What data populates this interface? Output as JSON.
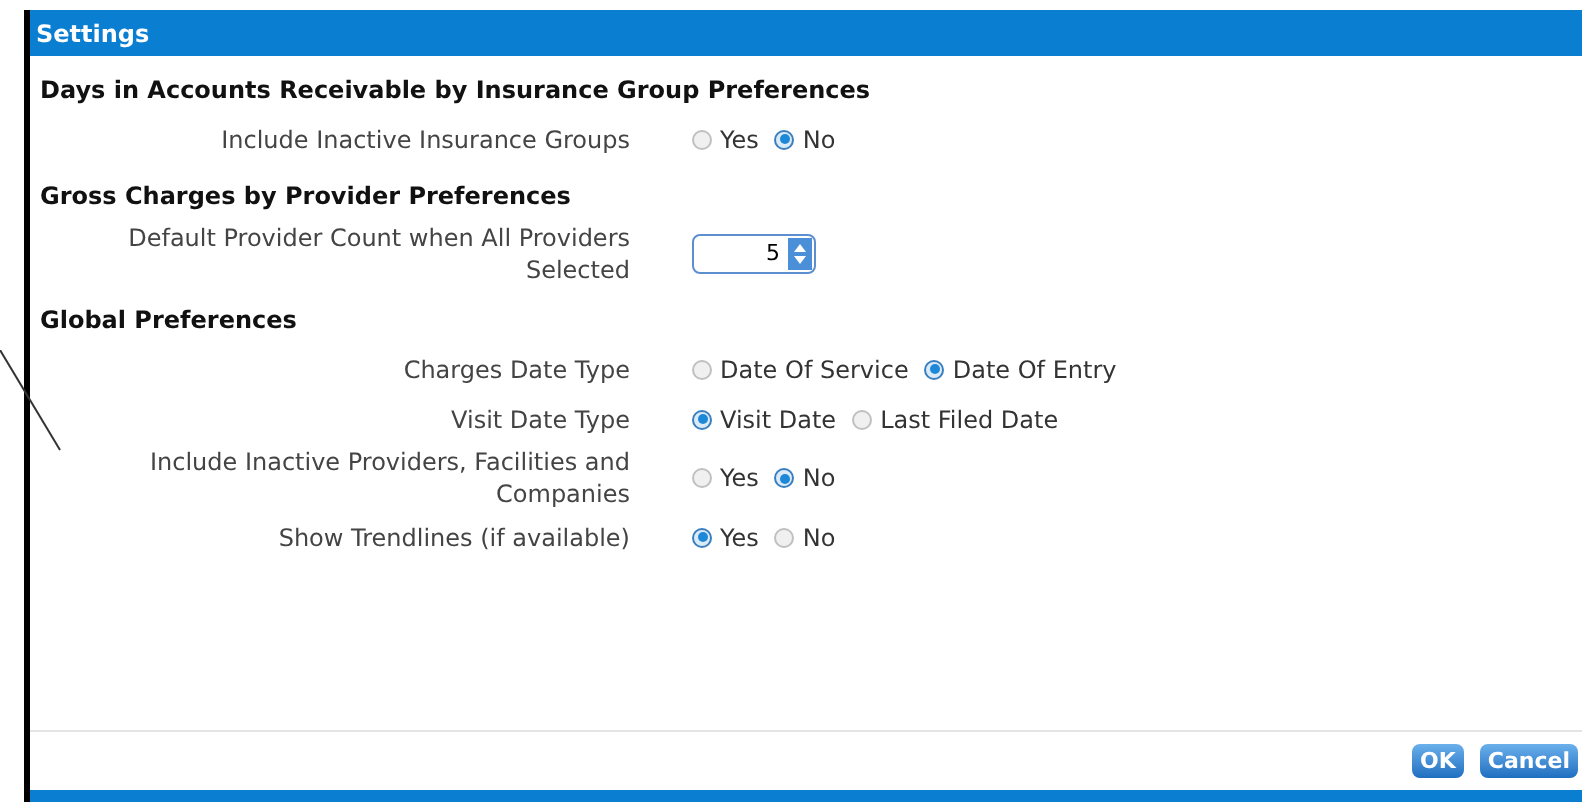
{
  "window": {
    "title": "Settings"
  },
  "sections": [
    {
      "heading": "Days in Accounts Receivable by Insurance Group Preferences",
      "rows": [
        {
          "kind": "radio",
          "label": "Include Inactive Insurance Groups",
          "options": [
            {
              "label": "Yes",
              "selected": false
            },
            {
              "label": "No",
              "selected": true
            }
          ]
        }
      ]
    },
    {
      "heading": "Gross Charges by Provider Preferences",
      "rows": [
        {
          "kind": "spinner",
          "label": "Default Provider Count when All Providers Selected",
          "value": "5"
        }
      ]
    },
    {
      "heading": "Global Preferences",
      "rows": [
        {
          "kind": "radio",
          "label": "Charges Date Type",
          "options": [
            {
              "label": "Date Of Service",
              "selected": false
            },
            {
              "label": "Date Of Entry",
              "selected": true
            }
          ]
        },
        {
          "kind": "radio",
          "label": "Visit Date Type",
          "options": [
            {
              "label": "Visit Date",
              "selected": true
            },
            {
              "label": "Last Filed Date",
              "selected": false
            }
          ]
        },
        {
          "kind": "radio",
          "label": "Include Inactive Providers, Facilities and Companies",
          "options": [
            {
              "label": "Yes",
              "selected": false
            },
            {
              "label": "No",
              "selected": true
            }
          ]
        },
        {
          "kind": "radio",
          "label": "Show Trendlines (if available)",
          "options": [
            {
              "label": "Yes",
              "selected": true
            },
            {
              "label": "No",
              "selected": false
            }
          ]
        }
      ]
    }
  ],
  "buttons": [
    "OK",
    "Cancel"
  ]
}
